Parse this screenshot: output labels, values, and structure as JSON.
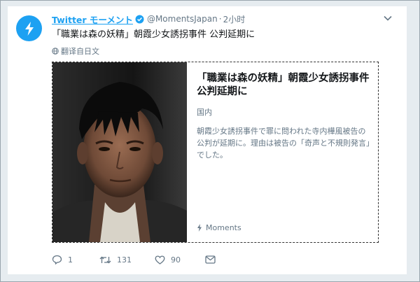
{
  "tweet": {
    "display_name": "Twitter モーメント",
    "handle": "@MomentsJapan",
    "separator": "·",
    "time": "2小时",
    "text": "「職業は森の妖精」朝霞少女誘拐事件 公判延期に",
    "translate": "翻译自日文"
  },
  "card": {
    "title": "「職業は森の妖精」朝霞少女誘拐事件 公判延期に",
    "category": "国内",
    "description": "朝霞少女誘拐事件で罪に問われた寺内樺風被告の公判が延期に。理由は被告の「奇声と不規則発言」でした。",
    "source": "Moments"
  },
  "actions": {
    "reply_count": "1",
    "retweet_count": "131",
    "like_count": "90"
  },
  "colors": {
    "accent": "#1da1f2",
    "muted": "#657786",
    "background": "#e6ecf0"
  },
  "icons": [
    "moments-bolt-icon",
    "verified-badge-icon",
    "chevron-down-icon",
    "globe-icon",
    "reply-icon",
    "retweet-icon",
    "like-icon",
    "message-icon"
  ]
}
